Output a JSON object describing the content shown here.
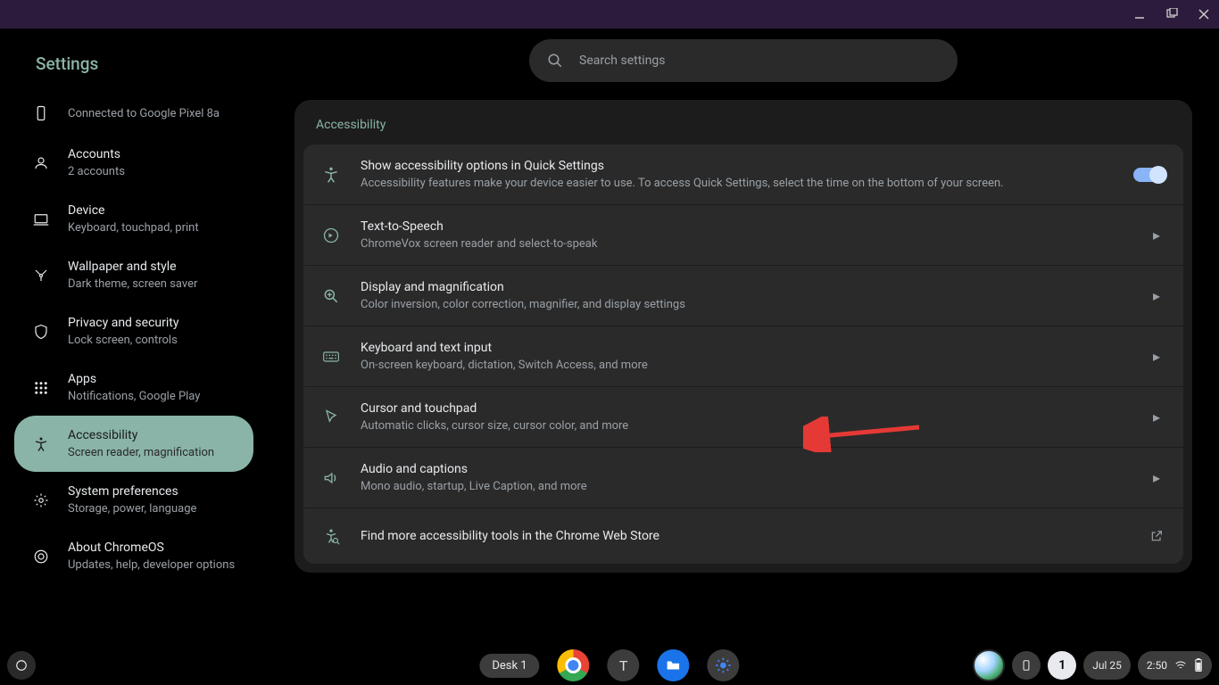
{
  "app_title": "Settings",
  "search": {
    "placeholder": "Search settings"
  },
  "sidebar": {
    "items": [
      {
        "label": "",
        "sub": "Connected to Google Pixel 8a",
        "icon": "phone-icon"
      },
      {
        "label": "Accounts",
        "sub": "2 accounts",
        "icon": "account-icon"
      },
      {
        "label": "Device",
        "sub": "Keyboard, touchpad, print",
        "icon": "laptop-icon"
      },
      {
        "label": "Wallpaper and style",
        "sub": "Dark theme, screen saver",
        "icon": "palette-icon"
      },
      {
        "label": "Privacy and security",
        "sub": "Lock screen, controls",
        "icon": "shield-icon"
      },
      {
        "label": "Apps",
        "sub": "Notifications, Google Play",
        "icon": "apps-icon"
      },
      {
        "label": "Accessibility",
        "sub": "Screen reader, magnification",
        "icon": "accessibility-icon",
        "selected": true
      },
      {
        "label": "System preferences",
        "sub": "Storage, power, language",
        "icon": "gear-icon"
      },
      {
        "label": "About ChromeOS",
        "sub": "Updates, help, developer options",
        "icon": "chrome-icon"
      }
    ]
  },
  "section": {
    "title": "Accessibility",
    "rows": [
      {
        "title": "Show accessibility options in Quick Settings",
        "sub": "Accessibility features make your device easier to use. To access Quick Settings, select the time on the bottom of your screen.",
        "icon": "accessibility-icon",
        "trail": "toggle",
        "toggle_on": true
      },
      {
        "title": "Text-to-Speech",
        "sub": "ChromeVox screen reader and select-to-speak",
        "icon": "tts-icon",
        "trail": "chevron"
      },
      {
        "title": "Display and magnification",
        "sub": "Color inversion, color correction, magnifier, and display settings",
        "icon": "magnify-icon",
        "trail": "chevron"
      },
      {
        "title": "Keyboard and text input",
        "sub": "On-screen keyboard, dictation, Switch Access, and more",
        "icon": "keyboard-icon",
        "trail": "chevron"
      },
      {
        "title": "Cursor and touchpad",
        "sub": "Automatic clicks, cursor size, cursor color, and more",
        "icon": "cursor-icon",
        "trail": "chevron"
      },
      {
        "title": "Audio and captions",
        "sub": "Mono audio, startup, Live Caption, and more",
        "icon": "audio-icon",
        "trail": "chevron"
      },
      {
        "title": "Find more accessibility tools in the Chrome Web Store",
        "sub": "",
        "icon": "webstore-icon",
        "trail": "external"
      }
    ]
  },
  "shelf": {
    "desk": "Desk 1",
    "apps": [
      {
        "name": "chrome",
        "letter": ""
      },
      {
        "name": "text",
        "letter": "T"
      },
      {
        "name": "files",
        "letter": ""
      },
      {
        "name": "settings",
        "letter": ""
      }
    ],
    "tray": {
      "notif_count": "1",
      "date": "Jul 25",
      "time": "2:50"
    }
  },
  "colors": {
    "accent": "#8ab4a8",
    "toggle": "#8ab4f8"
  }
}
